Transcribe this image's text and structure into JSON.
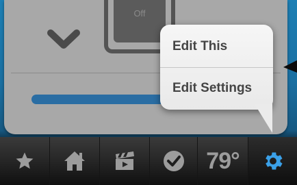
{
  "control": {
    "toggle_state": "Off",
    "slider_level": 0.95
  },
  "popover": {
    "items": [
      {
        "label": "Edit This"
      },
      {
        "label": "Edit Settings"
      }
    ]
  },
  "tabbar": {
    "tabs": [
      {
        "icon": "star-icon"
      },
      {
        "icon": "home-icon"
      },
      {
        "icon": "clapperboard-icon"
      },
      {
        "icon": "checkmark-icon"
      },
      {
        "icon": "temperature",
        "label": "79°"
      },
      {
        "icon": "gear-icon",
        "active": true
      }
    ]
  },
  "colors": {
    "backdrop_blue": "#1d7fb4",
    "slider_blue": "#2a6da3",
    "active_tab_blue": "#3aa0e8",
    "icon_grey": "#9c9c9c"
  }
}
